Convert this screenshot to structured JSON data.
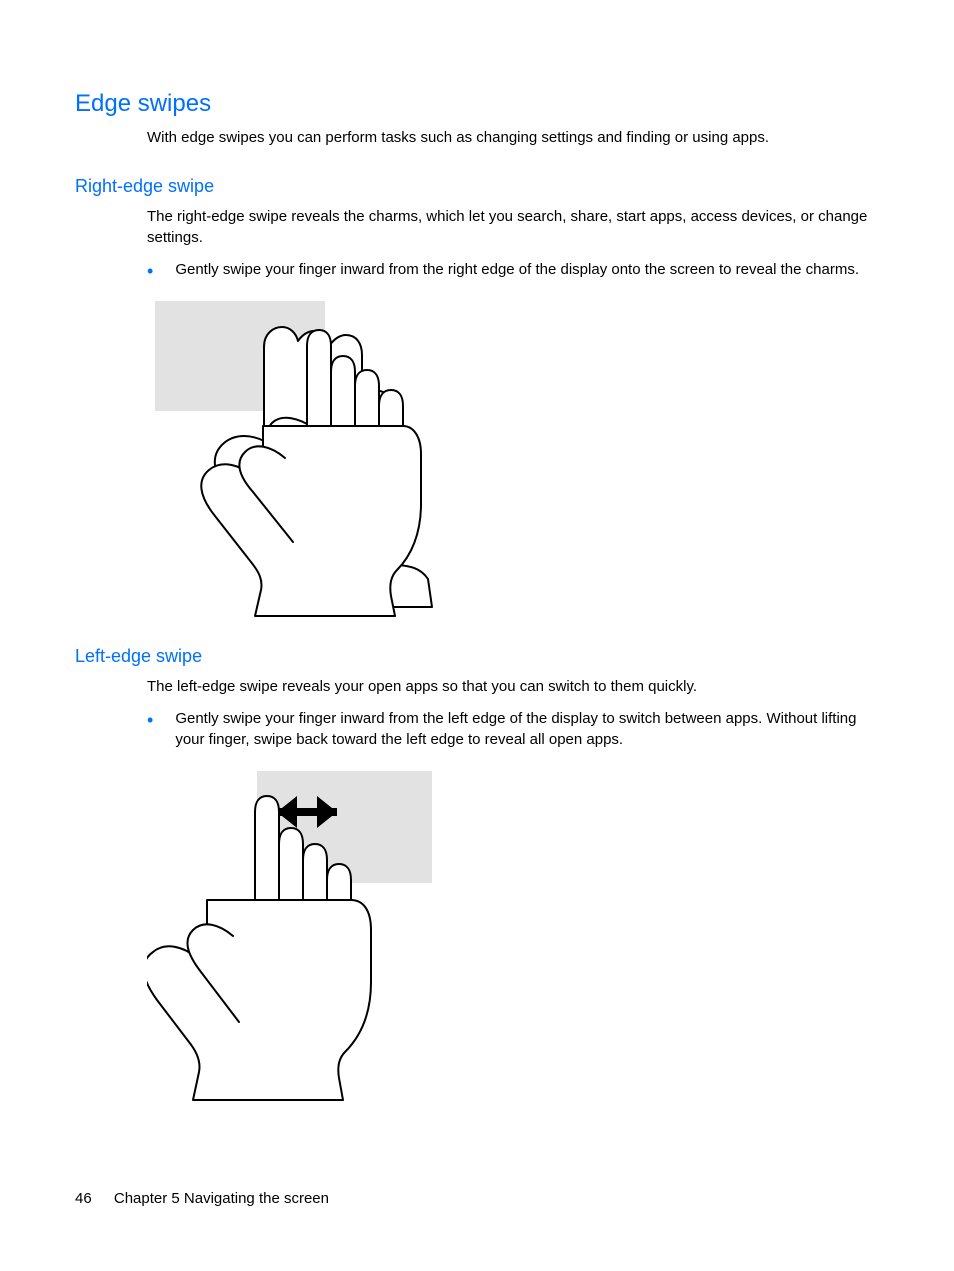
{
  "h1": "Edge swipes",
  "intro": "With edge swipes you can perform tasks such as changing settings and finding or using apps.",
  "section1": {
    "heading": "Right-edge swipe",
    "para": "The right-edge swipe reveals the charms, which let you search, share, start apps, access devices, or change settings.",
    "bullet": "Gently swipe your finger inward from the right edge of the display onto the screen to reveal the charms."
  },
  "section2": {
    "heading": "Left-edge swipe",
    "para": "The left-edge swipe reveals your open apps so that you can switch to them quickly.",
    "bullet": "Gently swipe your finger inward from the left edge of the display to switch between apps. Without lifting your finger, swipe back toward the left edge to reveal all open apps."
  },
  "footer": {
    "page": "46",
    "chapter": "Chapter 5   Navigating the screen"
  }
}
